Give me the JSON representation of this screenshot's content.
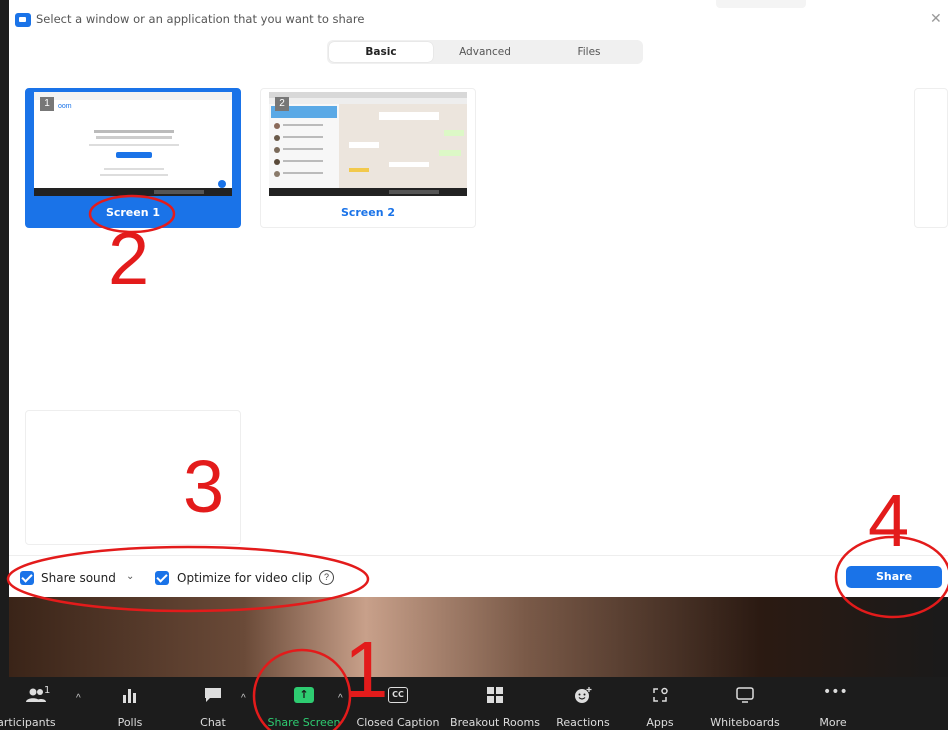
{
  "dialog": {
    "title": "Select a window or an application that you want to share",
    "tabs": [
      {
        "label": "Basic",
        "active": true
      },
      {
        "label": "Advanced",
        "active": false
      },
      {
        "label": "Files",
        "active": false
      }
    ],
    "screens": [
      {
        "number": "1",
        "label": "Screen 1",
        "selected": true
      },
      {
        "number": "2",
        "label": "Screen 2",
        "selected": false
      }
    ],
    "options": {
      "share_sound": "Share sound",
      "optimize": "Optimize for video clip"
    },
    "share_button": "Share"
  },
  "toolbar": {
    "participants": {
      "label": "Participants",
      "count": "1"
    },
    "polls": "Polls",
    "chat": "Chat",
    "share_screen": "Share Screen",
    "closed_caption": "Closed Caption",
    "breakout_rooms": "Breakout Rooms",
    "reactions": "Reactions",
    "apps": "Apps",
    "whiteboards": "Whiteboards",
    "more": "More"
  },
  "annotations": [
    "1",
    "2",
    "3",
    "4"
  ],
  "colors": {
    "accent": "#1a73e8",
    "annotation": "#e31b1b",
    "share_green": "#2ecc71",
    "toolbar_bg": "#1c1c1c"
  }
}
